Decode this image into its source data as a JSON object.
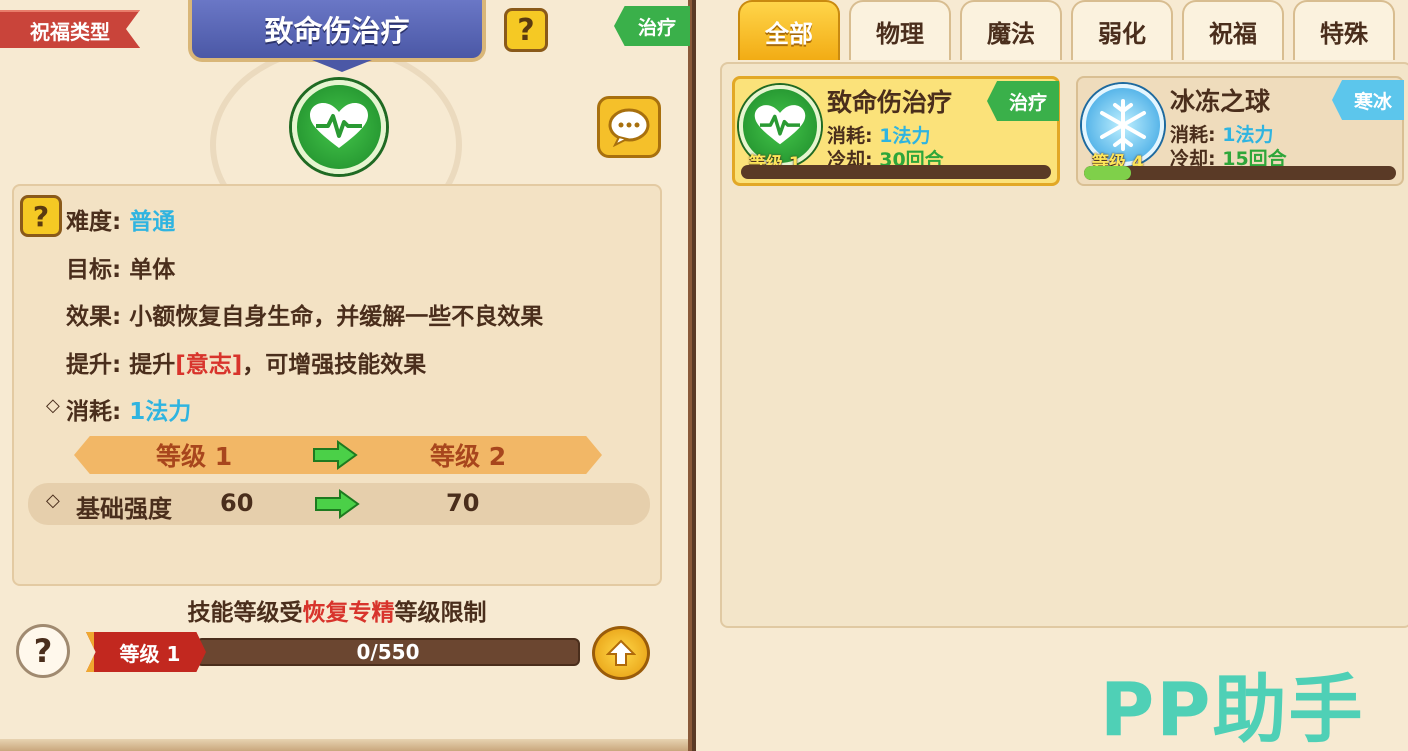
{
  "left_panel": {
    "type_ribbon": "祝福类型",
    "skill_title": "致命伤治疗",
    "help_glyph": "?",
    "category_tag": "治疗",
    "attributes": {
      "difficulty_label": "难度:",
      "difficulty_value": "普通",
      "target_label": "目标:",
      "target_value": "单体",
      "effect_label": "效果:",
      "effect_value": "小额恢复自身生命，并缓解一些不良效果",
      "boost_label": "提升:",
      "boost_prefix": "提升",
      "boost_highlight": "[意志]",
      "boost_suffix": "，可增强技能效果",
      "cost_marker": "◇",
      "cost_label": "消耗:",
      "cost_value": "1法力"
    },
    "level_compare": {
      "current": "等级 1",
      "next": "等级 2"
    },
    "stat_row": {
      "marker": "◇",
      "name": "基础强度",
      "current": "60",
      "next": "70"
    },
    "limit_text": {
      "prefix": "技能等级受",
      "highlight": "恢复专精",
      "suffix": "等级限制"
    },
    "level_ribbon": "等级 1",
    "xp_text": "0/550",
    "xp_progress": 0
  },
  "right_panel": {
    "tabs": [
      {
        "label": "全部",
        "active": true
      },
      {
        "label": "物理",
        "active": false
      },
      {
        "label": "魔法",
        "active": false
      },
      {
        "label": "弱化",
        "active": false
      },
      {
        "label": "祝福",
        "active": false
      },
      {
        "label": "特殊",
        "active": false
      }
    ],
    "cards": [
      {
        "name": "致命伤治疗",
        "tag": "治疗",
        "tag_color": "#3ab04a",
        "level": "等级 1",
        "cost_label": "消耗:",
        "cost_value": "1法力",
        "cooldown_label": "冷却:",
        "cooldown_value": "30回合",
        "progress": 0,
        "icon": "heart-pulse-icon",
        "selected": true
      },
      {
        "name": "冰冻之球",
        "tag": "寒冰",
        "tag_color": "#5cc6ec",
        "level": "等级 4",
        "cost_label": "消耗:",
        "cost_value": "1法力",
        "cooldown_label": "冷却:",
        "cooldown_value": "15回合",
        "progress": 0.15,
        "icon": "snowflake-icon",
        "selected": false
      }
    ]
  },
  "watermark": "PP助手",
  "colors": {
    "accent_gold": "#f2ac14",
    "heal_green": "#3ab04a",
    "ice_blue": "#5cc6ec",
    "value_blue": "#2fb4e0",
    "highlight_red": "#d8342c"
  }
}
